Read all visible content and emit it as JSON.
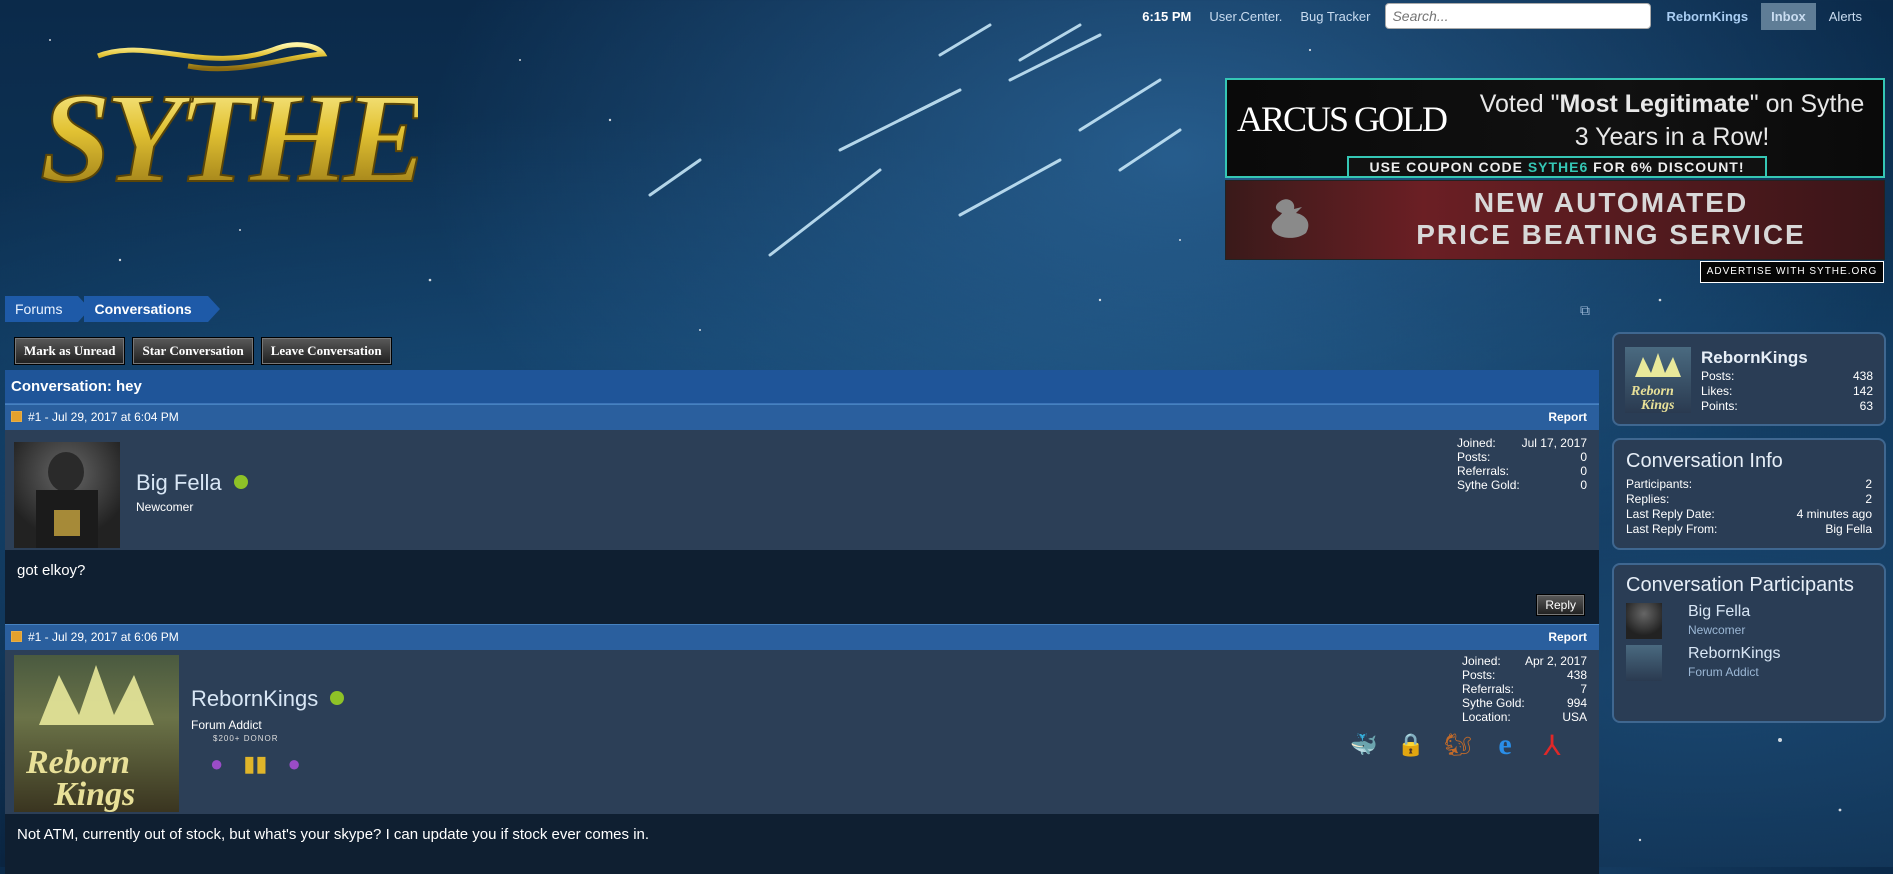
{
  "topbar": {
    "time": "6:15 PM",
    "user_center": "User Center.",
    "bug_tracker": "Bug Tracker",
    "search_placeholder": "Search...",
    "username": "RebornKings",
    "inbox": "Inbox",
    "alerts": "Alerts"
  },
  "logo_text": "SYTHE",
  "ads": {
    "ad1_brand": "ARCUS GOLD",
    "ad1_slogan_pre": "Voted \"",
    "ad1_slogan_bold": "Most Legitimate",
    "ad1_slogan_post": "\" on Sythe",
    "ad1_slogan_line2": "3 Years in a Row!",
    "ad1_coupon_pre": "USE COUPON CODE ",
    "ad1_coupon_code": "SYTHE6",
    "ad1_coupon_post": " FOR 6% DISCOUNT!",
    "ad2_line1": "NEW AUTOMATED",
    "ad2_line2": "PRICE BEATING SERVICE",
    "advertise": "ADVERTISE WITH SYTHE.ORG"
  },
  "breadcrumb": [
    "Forums",
    "Conversations"
  ],
  "actions": {
    "mark_unread": "Mark as Unread",
    "star": "Star Conversation",
    "leave": "Leave Conversation"
  },
  "conversation": {
    "title": "Conversation: hey",
    "messages": [
      {
        "header": "#1 - Jul 29, 2017 at 6:04 PM",
        "report": "Report",
        "author": "Big Fella",
        "role": "Newcomer",
        "stats": [
          {
            "label": "Joined:",
            "value": "Jul 17, 2017"
          },
          {
            "label": "Posts:",
            "value": "0"
          },
          {
            "label": "Referrals:",
            "value": "0"
          },
          {
            "label": "Sythe Gold:",
            "value": "0"
          }
        ],
        "body": "got elkoy?",
        "reply": "Reply"
      },
      {
        "header": "#1 - Jul 29, 2017 at 6:06 PM",
        "report": "Report",
        "author": "RebornKings",
        "role": "Forum Addict",
        "donor": "$200+ DONOR",
        "stats": [
          {
            "label": "Joined:",
            "value": "Apr 2, 2017"
          },
          {
            "label": "Posts:",
            "value": "438"
          },
          {
            "label": "Referrals:",
            "value": "7"
          },
          {
            "label": "Sythe Gold:",
            "value": "994"
          },
          {
            "label": "Location:",
            "value": "USA"
          }
        ],
        "body": "Not ATM, currently out of stock, but what's your skype? I can update you if stock ever comes in."
      }
    ]
  },
  "sidebar": {
    "profile": {
      "name": "RebornKings",
      "stats": [
        {
          "label": "Posts:",
          "value": "438"
        },
        {
          "label": "Likes:",
          "value": "142"
        },
        {
          "label": "Points:",
          "value": "63"
        }
      ]
    },
    "info": {
      "title": "Conversation Info",
      "rows": [
        {
          "label": "Participants:",
          "value": "2"
        },
        {
          "label": "Replies:",
          "value": "2"
        },
        {
          "label": "Last Reply Date:",
          "value": "4 minutes ago"
        },
        {
          "label": "Last Reply From:",
          "value": "Big Fella"
        }
      ]
    },
    "participants": {
      "title": "Conversation Participants",
      "list": [
        {
          "name": "Big Fella",
          "role": "Newcomer"
        },
        {
          "name": "RebornKings",
          "role": "Forum Addict"
        }
      ]
    }
  },
  "colors": {
    "accent": "#1f5599",
    "online": "#8ec227",
    "ad_border": "#35c7b5"
  }
}
